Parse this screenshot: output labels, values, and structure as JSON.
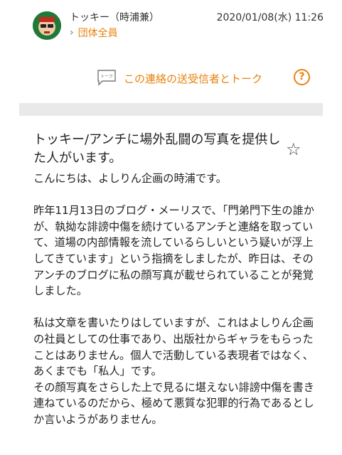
{
  "header": {
    "sender_name": "トッキー（時浦兼）",
    "chevron": "›",
    "group": "団体全員",
    "datetime": "2020/01/08(水) 11:26",
    "avatar_icon": "avatar-icon"
  },
  "talk": {
    "icon_text": "トーク",
    "label": "この連絡の送受信者とトーク",
    "help": "?"
  },
  "message": {
    "title": "トッキー/アンチに場外乱闘の写真を提供した人がいます。",
    "star": "☆",
    "greeting": "こんにちは、よしりん企画の時浦です。",
    "p1": "昨年11月13日のブログ・メーリスで、「門弟門下生の誰かが、執拗な誹謗中傷を続けているアンチと連絡を取っていて、道場の内部情報を流しているらしいという疑いが浮上してきています」という指摘をしましたが、昨日は、そのアンチのブログに私の顔写真が載せられていることが発覚しました。",
    "p2": "私は文章を書いたりはしていますが、これはよしりん企画の社員としての仕事であり、出版社からギャラをもらったことはありません。個人で活動している表現者ではなく、あくまでも「私人」です。",
    "p3": "その顔写真をさらした上で見るに堪えない誹謗中傷を書き連ねているのだから、極めて悪質な犯罪的行為であるとしか言いようがありません。"
  },
  "colors": {
    "accent": "#e8820c",
    "divider": "#e9e9e9"
  }
}
